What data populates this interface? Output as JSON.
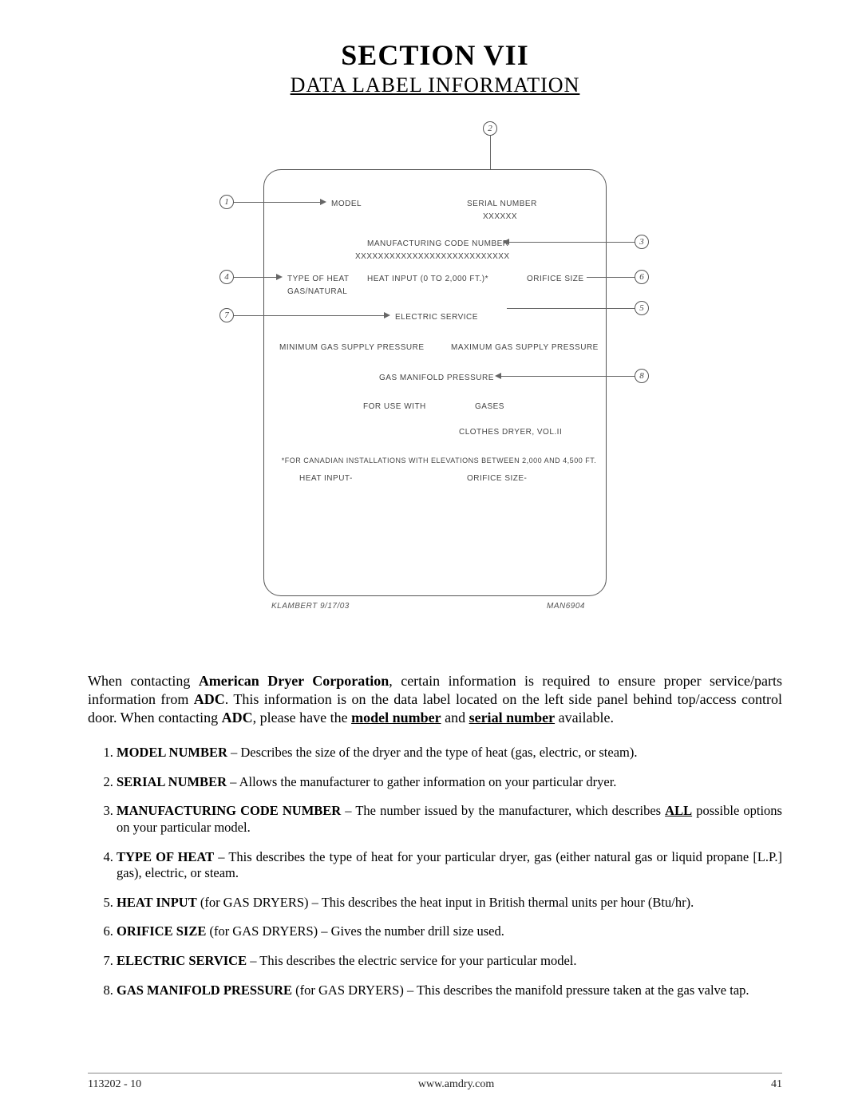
{
  "header": {
    "section": "SECTION VII",
    "subtitle": "DATA LABEL INFORMATION"
  },
  "diagram": {
    "callouts": {
      "1": "1",
      "2": "2",
      "3": "3",
      "4": "4",
      "5": "5",
      "6": "6",
      "7": "7",
      "8": "8"
    },
    "labels": {
      "model": "MODEL",
      "serial": "SERIAL NUMBER",
      "serial_x": "XXXXXX",
      "mfg": "MANUFACTURING CODE NUMBER",
      "mfg_x": "XXXXXXXXXXXXXXXXXXXXXXXXXXX",
      "type_of_heat": "TYPE OF HEAT",
      "heat_input": "HEAT INPUT (0 TO 2,000 FT.)*",
      "orifice": "ORIFICE SIZE",
      "gas_natural": "GAS/NATURAL",
      "electric": "ELECTRIC SERVICE",
      "min_gas": "MINIMUM GAS SUPPLY PRESSURE",
      "max_gas": "MAXIMUM GAS SUPPLY PRESSURE",
      "manifold": "GAS MANIFOLD PRESSURE",
      "for_use": "FOR USE WITH",
      "gases": "GASES",
      "clothes": "CLOTHES DRYER, VOL.II",
      "canada": "*FOR CANADIAN INSTALLATIONS WITH ELEVATIONS BETWEEN 2,000 AND 4,500 FT.",
      "heat_input2": "HEAT INPUT-",
      "orifice2": "ORIFICE SIZE-"
    },
    "foot_left": "KLAMBERT 9/17/03",
    "foot_right": "MAN6904"
  },
  "paragraph": {
    "p1a": "When contacting ",
    "p1b": "American Dryer Corporation",
    "p1c": ", certain information is required to ensure proper service/parts information from ",
    "p1d": "ADC",
    "p1e": ".  This information is on the data label located on the left side panel behind top/access control door.  When contacting ",
    "p1f": "ADC",
    "p1g": ", please have the ",
    "p1h": "model number",
    "p1i": " and ",
    "p1j": "serial number",
    "p1k": " available."
  },
  "definitions": [
    {
      "term": "MODEL NUMBER",
      "desc": " – Describes the size of the dryer and the type of heat (gas, electric, or steam)."
    },
    {
      "term": "SERIAL NUMBER",
      "desc": " – Allows the manufacturer to gather information on your particular dryer."
    },
    {
      "term": "MANUFACTURING CODE NUMBER",
      "desc_pre": " – The number issued by the manufacturer, which describes ",
      "desc_u": "ALL",
      "desc_post": " possible options on your particular model."
    },
    {
      "term": "TYPE OF HEAT",
      "desc": " – This describes the type of heat for your particular dryer, gas (either natural gas or liquid propane [L.P.] gas), electric, or steam."
    },
    {
      "term": "HEAT INPUT",
      "qual": " (for GAS DRYERS)",
      "desc": " – This describes the heat input in British thermal units per hour (Btu/hr)."
    },
    {
      "term": "ORIFICE SIZE",
      "qual": " (for GAS DRYERS)",
      "desc": " – Gives the number drill size used."
    },
    {
      "term": "ELECTRIC SERVICE",
      "desc": " – This describes the electric service for your particular model."
    },
    {
      "term": "GAS MANIFOLD PRESSURE",
      "qual": " (for GAS DRYERS)",
      "desc": " – This describes the manifold pressure taken at the gas valve tap."
    }
  ],
  "footer": {
    "left": "113202 - 10",
    "center": "www.amdry.com",
    "right": "41"
  }
}
